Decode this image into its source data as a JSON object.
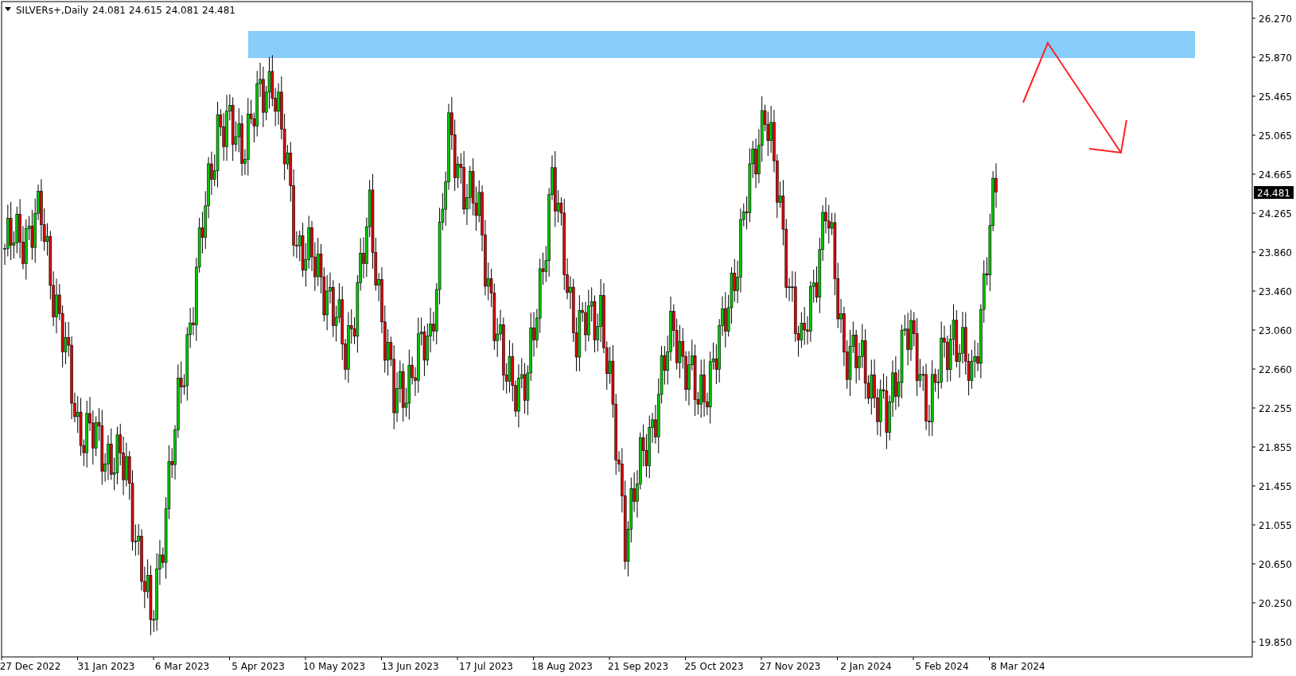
{
  "chart": {
    "symbol": "SILVERs+,Daily",
    "ohlc": [
      "24.081",
      "24.615",
      "24.081",
      "24.481"
    ],
    "y_axis": [
      "26.270",
      "25.870",
      "25.465",
      "25.065",
      "24.665",
      "24.265",
      "23.860",
      "23.460",
      "23.060",
      "22.660",
      "22.255",
      "21.855",
      "21.455",
      "21.055",
      "20.650",
      "20.250",
      "19.850"
    ],
    "current_price": "24.481",
    "x_axis": [
      "27 Dec 2022",
      "31 Jan 2023",
      "6 Mar 2023",
      "5 Apr 2023",
      "10 May 2023",
      "13 Jun 2023",
      "17 Jul 2023",
      "18 Aug 2023",
      "21 Sep 2023",
      "25 Oct 2023",
      "27 Nov 2023",
      "2 Jan 2024",
      "5 Feb 2024",
      "8 Mar 2024"
    ]
  }
}
